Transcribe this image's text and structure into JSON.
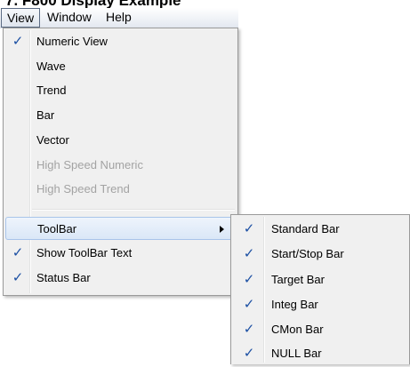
{
  "page_title": "7. F800 Display Example",
  "menubar": {
    "items": [
      {
        "label": "View",
        "active": true
      },
      {
        "label": "Window",
        "active": false
      },
      {
        "label": "Help",
        "active": false
      }
    ]
  },
  "view_menu": {
    "items": [
      {
        "label": "Numeric View",
        "checked": true,
        "enabled": true
      },
      {
        "label": "Wave",
        "checked": false,
        "enabled": true
      },
      {
        "label": "Trend",
        "checked": false,
        "enabled": true
      },
      {
        "label": "Bar",
        "checked": false,
        "enabled": true
      },
      {
        "label": "Vector",
        "checked": false,
        "enabled": true
      },
      {
        "label": "High Speed Numeric",
        "checked": false,
        "enabled": false
      },
      {
        "label": "High Speed Trend",
        "checked": false,
        "enabled": false
      },
      {
        "label": "ToolBar",
        "checked": false,
        "enabled": true,
        "submenu": true,
        "highlighted": true
      },
      {
        "label": "Show ToolBar Text",
        "checked": true,
        "enabled": true
      },
      {
        "label": "Status Bar",
        "checked": true,
        "enabled": true
      }
    ]
  },
  "toolbar_submenu": {
    "items": [
      {
        "label": "Standard Bar",
        "checked": true
      },
      {
        "label": "Start/Stop Bar",
        "checked": true
      },
      {
        "label": "Target Bar",
        "checked": true
      },
      {
        "label": "Integ Bar",
        "checked": true
      },
      {
        "label": "CMon Bar",
        "checked": true
      },
      {
        "label": "NULL Bar",
        "checked": true
      }
    ]
  },
  "icons": {
    "check": "checkmark-icon",
    "submenu_arrow": "submenu-arrow-icon"
  },
  "colors": {
    "check": "#1b4fa3",
    "highlight": "#dae7f7",
    "disabled_text": "#a3a3a3"
  }
}
